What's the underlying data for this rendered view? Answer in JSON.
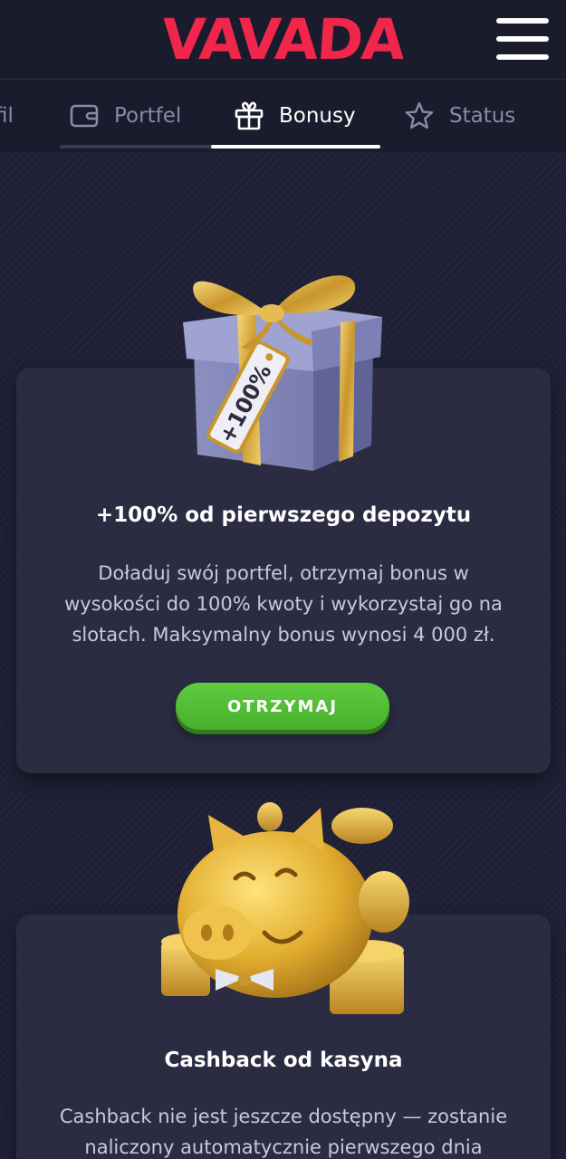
{
  "header": {
    "logo_text": "VAVADA",
    "menu_icon": "hamburger-menu-icon",
    "brand_color": "#f0264b"
  },
  "tabs": [
    {
      "label": "fil",
      "icon": "user-icon",
      "active": false
    },
    {
      "label": "Portfel",
      "icon": "wallet-icon",
      "active": false
    },
    {
      "label": "Bonusy",
      "icon": "gift-icon",
      "active": true
    },
    {
      "label": "Status",
      "icon": "star-icon",
      "active": false
    }
  ],
  "cards": [
    {
      "illustration": "gift-box-100-percent",
      "tag_text": "+100%",
      "title": "+100% od pierwszego depozytu",
      "text_lines": [
        "Doładuj swój portfel, otrzymaj bonus w",
        "wysokości do 100% kwoty i wykorzystaj go na",
        "slotach. Maksymalny bonus wynosi 4 000 zł."
      ],
      "button_label": "OTRZYMAJ",
      "button_color": "#55c036"
    },
    {
      "illustration": "golden-piggy-bank",
      "title": "Cashback od kasyna",
      "text_lines": [
        "Cashback nie jest jeszcze dostępny — zostanie",
        "naliczony automatycznie pierwszego dnia"
      ]
    }
  ]
}
